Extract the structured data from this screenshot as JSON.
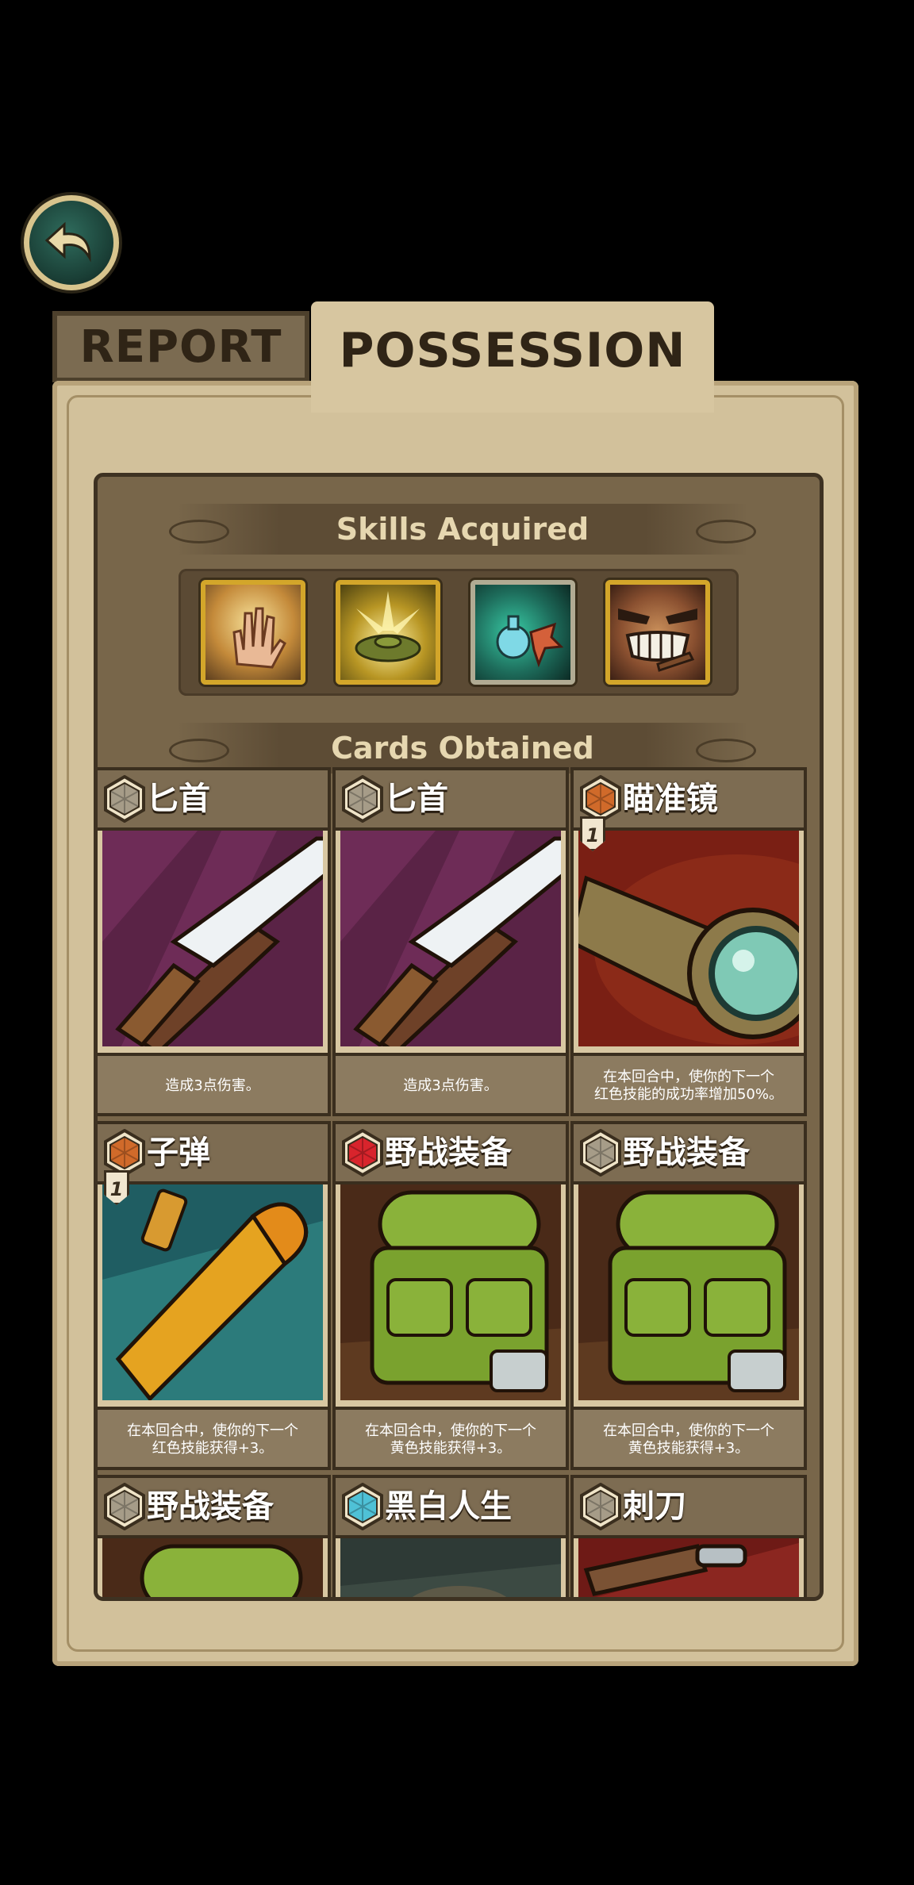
{
  "tabs": {
    "report": "REPORT",
    "possession": "POSSESSION",
    "active": "possession"
  },
  "sections": {
    "skills_title": "Skills Acquired",
    "cards_title": "Cards Obtained"
  },
  "skills": [
    {
      "icon": "glowing-hand-icon",
      "frame": "gold"
    },
    {
      "icon": "landmine-icon",
      "frame": "gold"
    },
    {
      "icon": "poison-flask-icon",
      "frame": "silver"
    },
    {
      "icon": "grinning-face-icon",
      "frame": "gold"
    }
  ],
  "cards": [
    {
      "name": "匕首",
      "gem": "grey",
      "art": "dagger",
      "cost": "",
      "desc": "造成3点伤害。"
    },
    {
      "name": "匕首",
      "gem": "grey",
      "art": "dagger",
      "cost": "",
      "desc": "造成3点伤害。"
    },
    {
      "name": "瞄准镜",
      "gem": "orange",
      "art": "scope",
      "cost": "1",
      "desc": "在本回合中，使你的下一个\n红色技能的成功率增加50%。"
    },
    {
      "name": "子弹",
      "gem": "orange",
      "art": "bullet",
      "cost": "1",
      "desc": "在本回合中，使你的下一个\n红色技能获得+3。"
    },
    {
      "name": "野战装备",
      "gem": "red",
      "art": "backpack",
      "cost": "",
      "desc": "在本回合中，使你的下一个\n黄色技能获得+3。"
    },
    {
      "name": "野战装备",
      "gem": "grey",
      "art": "backpack",
      "cost": "",
      "desc": "在本回合中，使你的下一个\n黄色技能获得+3。"
    },
    {
      "name": "野战装备",
      "gem": "grey",
      "art": "backpack",
      "cost": "",
      "desc": ""
    },
    {
      "name": "黑白人生",
      "gem": "blue",
      "art": "dark",
      "cost": "",
      "desc": ""
    },
    {
      "name": "刺刀",
      "gem": "grey",
      "art": "bayonet",
      "cost": "",
      "desc": ""
    }
  ],
  "colors": {
    "panel": "#78664a",
    "frame": "#d2c19b",
    "gold_frame": "#d3a62a",
    "back_button": "#2f6c5d"
  }
}
